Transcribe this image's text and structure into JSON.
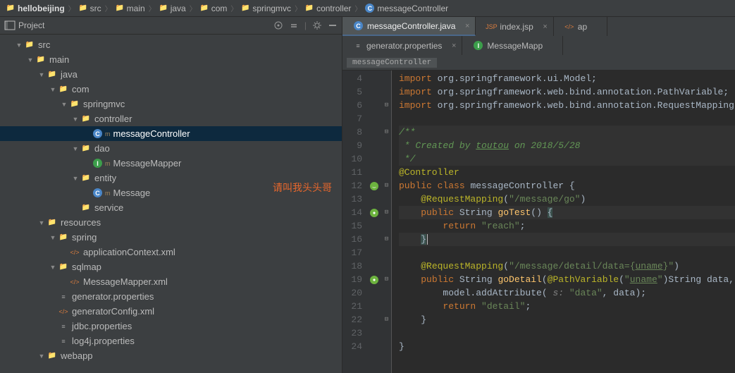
{
  "breadcrumb": [
    {
      "icon": "folder",
      "label": "hellobeijing",
      "bold": true
    },
    {
      "icon": "folder",
      "label": "src"
    },
    {
      "icon": "folder",
      "label": "main"
    },
    {
      "icon": "folder",
      "label": "java"
    },
    {
      "icon": "package",
      "label": "com"
    },
    {
      "icon": "package",
      "label": "springmvc"
    },
    {
      "icon": "package",
      "label": "controller"
    },
    {
      "icon": "class",
      "label": "messageController"
    }
  ],
  "project_panel": {
    "title": "Project",
    "tools": [
      "target-icon",
      "collapse-icon",
      "gear-icon",
      "hide-icon"
    ]
  },
  "tree": [
    {
      "indent": 1,
      "arrow": "down",
      "icon": "folder",
      "label": "src"
    },
    {
      "indent": 2,
      "arrow": "down",
      "icon": "folder",
      "label": "main"
    },
    {
      "indent": 3,
      "arrow": "down",
      "icon": "folder",
      "label": "java"
    },
    {
      "indent": 4,
      "arrow": "down",
      "icon": "package",
      "label": "com"
    },
    {
      "indent": 5,
      "arrow": "down",
      "icon": "package",
      "label": "springmvc"
    },
    {
      "indent": 6,
      "arrow": "down",
      "icon": "package",
      "label": "controller"
    },
    {
      "indent": 7,
      "arrow": "",
      "icon": "class",
      "label": "messageController",
      "selected": true,
      "hasSub": "m"
    },
    {
      "indent": 6,
      "arrow": "down",
      "icon": "package",
      "label": "dao"
    },
    {
      "indent": 7,
      "arrow": "",
      "icon": "iface",
      "label": "MessageMapper",
      "hasSub": "m"
    },
    {
      "indent": 6,
      "arrow": "down",
      "icon": "package",
      "label": "entity"
    },
    {
      "indent": 7,
      "arrow": "",
      "icon": "class",
      "label": "Message",
      "hasSub": "m"
    },
    {
      "indent": 6,
      "arrow": "",
      "icon": "package",
      "label": "service"
    },
    {
      "indent": 3,
      "arrow": "down",
      "icon": "folder",
      "label": "resources"
    },
    {
      "indent": 4,
      "arrow": "down",
      "icon": "folder",
      "label": "spring"
    },
    {
      "indent": 5,
      "arrow": "",
      "icon": "xml",
      "label": "applicationContext.xml"
    },
    {
      "indent": 4,
      "arrow": "down",
      "icon": "folder",
      "label": "sqlmap"
    },
    {
      "indent": 5,
      "arrow": "",
      "icon": "xml",
      "label": "MessageMapper.xml"
    },
    {
      "indent": 4,
      "arrow": "",
      "icon": "props",
      "label": "generator.properties"
    },
    {
      "indent": 4,
      "arrow": "",
      "icon": "xml",
      "label": "generatorConfig.xml"
    },
    {
      "indent": 4,
      "arrow": "",
      "icon": "props",
      "label": "jdbc.properties"
    },
    {
      "indent": 4,
      "arrow": "",
      "icon": "props",
      "label": "log4j.properties"
    },
    {
      "indent": 3,
      "arrow": "down",
      "icon": "folder",
      "label": "webapp"
    }
  ],
  "watermark": "请叫我头头哥",
  "editor_tabs_row1": [
    {
      "icon": "class",
      "label": "messageController.java",
      "active": true,
      "closable": true
    },
    {
      "icon": "jsp",
      "label": "index.jsp",
      "active": false,
      "closable": true
    },
    {
      "icon": "xml",
      "label": "ap",
      "active": false,
      "closable": false
    }
  ],
  "editor_tabs_row2": [
    {
      "icon": "props",
      "label": "generator.properties",
      "active": false,
      "closable": true
    },
    {
      "icon": "iface",
      "label": "MessageMapp",
      "active": false,
      "closable": false
    }
  ],
  "editor_crumb": "messageController",
  "code_start_line": 4,
  "code_lines": [
    {
      "n": 4,
      "gutter": "",
      "fold": "",
      "html": "<span class='kw'>import</span> org.springframework.ui.Model;"
    },
    {
      "n": 5,
      "gutter": "",
      "fold": "",
      "html": "<span class='kw'>import</span> org.springframework.web.bind.annotation.PathVariable;"
    },
    {
      "n": 6,
      "gutter": "",
      "fold": "⊟",
      "html": "<span class='kw'>import</span> org.springframework.web.bind.annotation.RequestMapping;"
    },
    {
      "n": 7,
      "gutter": "",
      "fold": "",
      "html": ""
    },
    {
      "n": 8,
      "gutter": "",
      "fold": "⊟",
      "html": "<span class='cmtblk'>/**</span>",
      "hl": true
    },
    {
      "n": 9,
      "gutter": "",
      "fold": "",
      "html": "<span class='cmtblk'> * Created by <u>toutou</u> on 2018/5/28</span>",
      "hl": true
    },
    {
      "n": 10,
      "gutter": "",
      "fold": "",
      "html": "<span class='cmtblk'> */</span>",
      "hl": true
    },
    {
      "n": 11,
      "gutter": "",
      "fold": "",
      "html": "<span class='ann'>@Controller</span>"
    },
    {
      "n": 12,
      "gutter": "bean",
      "fold": "⊟",
      "html": "<span class='kw'>public</span> <span class='kw'>class</span> messageController {"
    },
    {
      "n": 13,
      "gutter": "",
      "fold": "",
      "html": "    <span class='ann'>@RequestMapping</span>(<span class='str'>\"/message/go\"</span>)"
    },
    {
      "n": 14,
      "gutter": "nav",
      "fold": "⊟",
      "html": "    <span class='kw'>public</span> String <span class='mname'>goTest</span>() <span style='background:#3b514d'>{</span>",
      "active": true
    },
    {
      "n": 15,
      "gutter": "",
      "fold": "",
      "html": "        <span class='kw'>return</span> <span class='str'>\"reach\"</span>;"
    },
    {
      "n": 16,
      "gutter": "",
      "fold": "⊟",
      "html": "    <span style='background:#3b514d'>}</span><span class='caret'></span>",
      "active": true
    },
    {
      "n": 17,
      "gutter": "",
      "fold": "",
      "html": ""
    },
    {
      "n": 18,
      "gutter": "",
      "fold": "",
      "html": "    <span class='ann'>@RequestMapping</span>(<span class='str'>\"/message/detail/data={<u>uname</u>}\"</span>)"
    },
    {
      "n": 19,
      "gutter": "nav",
      "fold": "⊟",
      "html": "    <span class='kw'>public</span> String <span class='mname'>goDetail</span>(<span class='ann'>@PathVariable</span>(<span class='str'>\"<u>uname</u>\"</span>)String data, Model model){"
    },
    {
      "n": 20,
      "gutter": "",
      "fold": "",
      "html": "        model.addAttribute( <span class='cmt'>s:</span> <span class='str'>\"data\"</span>, data);"
    },
    {
      "n": 21,
      "gutter": "",
      "fold": "",
      "html": "        <span class='kw'>return</span> <span class='str'>\"detail\"</span>;"
    },
    {
      "n": 22,
      "gutter": "",
      "fold": "⊟",
      "html": "    }"
    },
    {
      "n": 23,
      "gutter": "",
      "fold": "",
      "html": ""
    },
    {
      "n": 24,
      "gutter": "",
      "fold": "",
      "html": "}"
    }
  ]
}
